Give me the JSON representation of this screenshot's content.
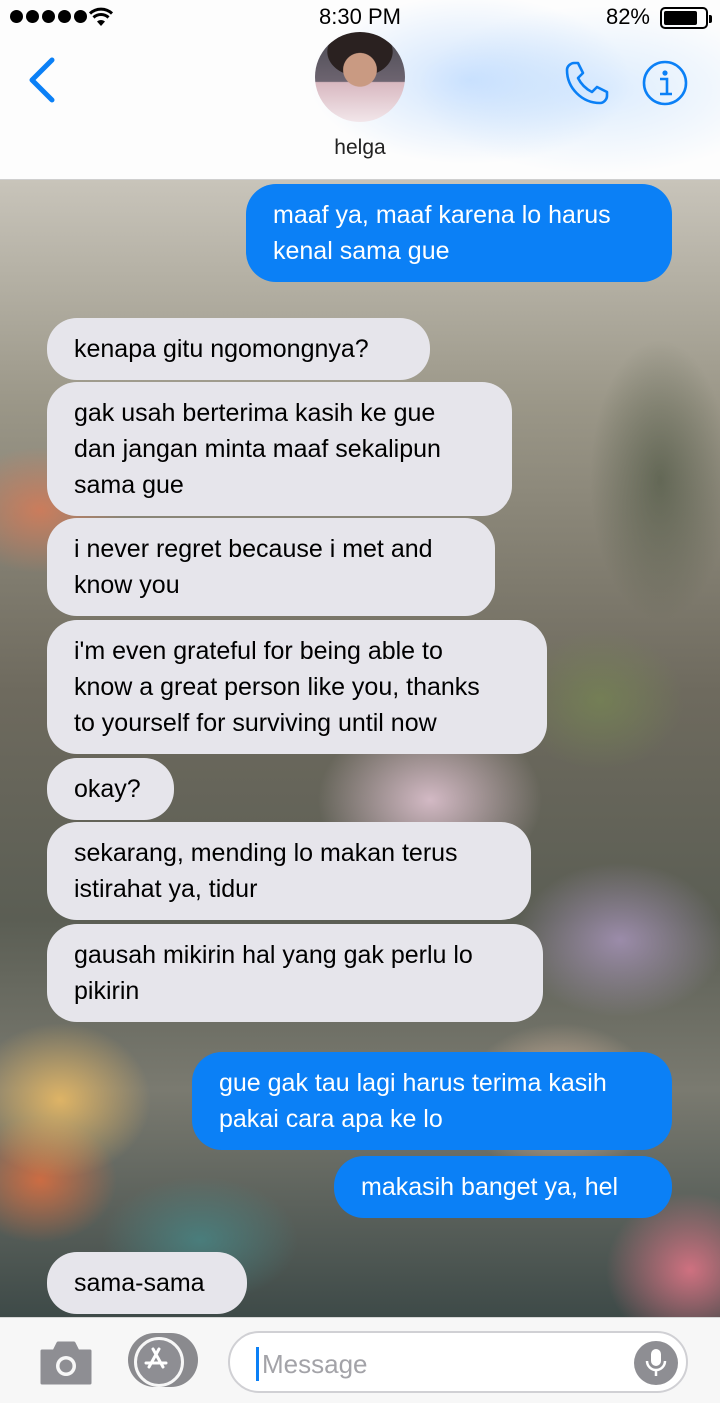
{
  "status_bar": {
    "time": "8:30 PM",
    "battery": "82%",
    "battery_level": 0.82
  },
  "header": {
    "contact_name": "helga",
    "back_icon": "chevron-left-icon",
    "call_icon": "phone-icon",
    "info_icon": "info-icon"
  },
  "messages": [
    {
      "from": "me",
      "text": "maaf ya, maaf karena lo harus\nkenal sama gue"
    },
    {
      "from": "them",
      "text": "kenapa gitu ngomongnya?"
    },
    {
      "from": "them",
      "text": "gak usah berterima kasih ke gue\ndan jangan minta maaf sekalipun\nsama gue"
    },
    {
      "from": "them",
      "text": "i never regret because i met and\nknow you"
    },
    {
      "from": "them",
      "text": "i'm even grateful for being able to\nknow a great person like you, thanks\nto yourself for surviving until now"
    },
    {
      "from": "them",
      "text": "okay?"
    },
    {
      "from": "them",
      "text": "sekarang, mending lo makan terus\nistirahat ya, tidur"
    },
    {
      "from": "them",
      "text": "gausah mikirin hal yang gak perlu lo\npikirin"
    },
    {
      "from": "me",
      "text": "gue gak tau lagi harus terima kasih\npakai cara apa ke lo"
    },
    {
      "from": "me",
      "text": "makasih banget ya, hel"
    },
    {
      "from": "them",
      "text": "sama-sama"
    }
  ],
  "input": {
    "placeholder": "Message"
  },
  "colors": {
    "outgoing": "#0b80f6",
    "incoming": "#e6e5eb",
    "accent": "#0b80f6"
  }
}
